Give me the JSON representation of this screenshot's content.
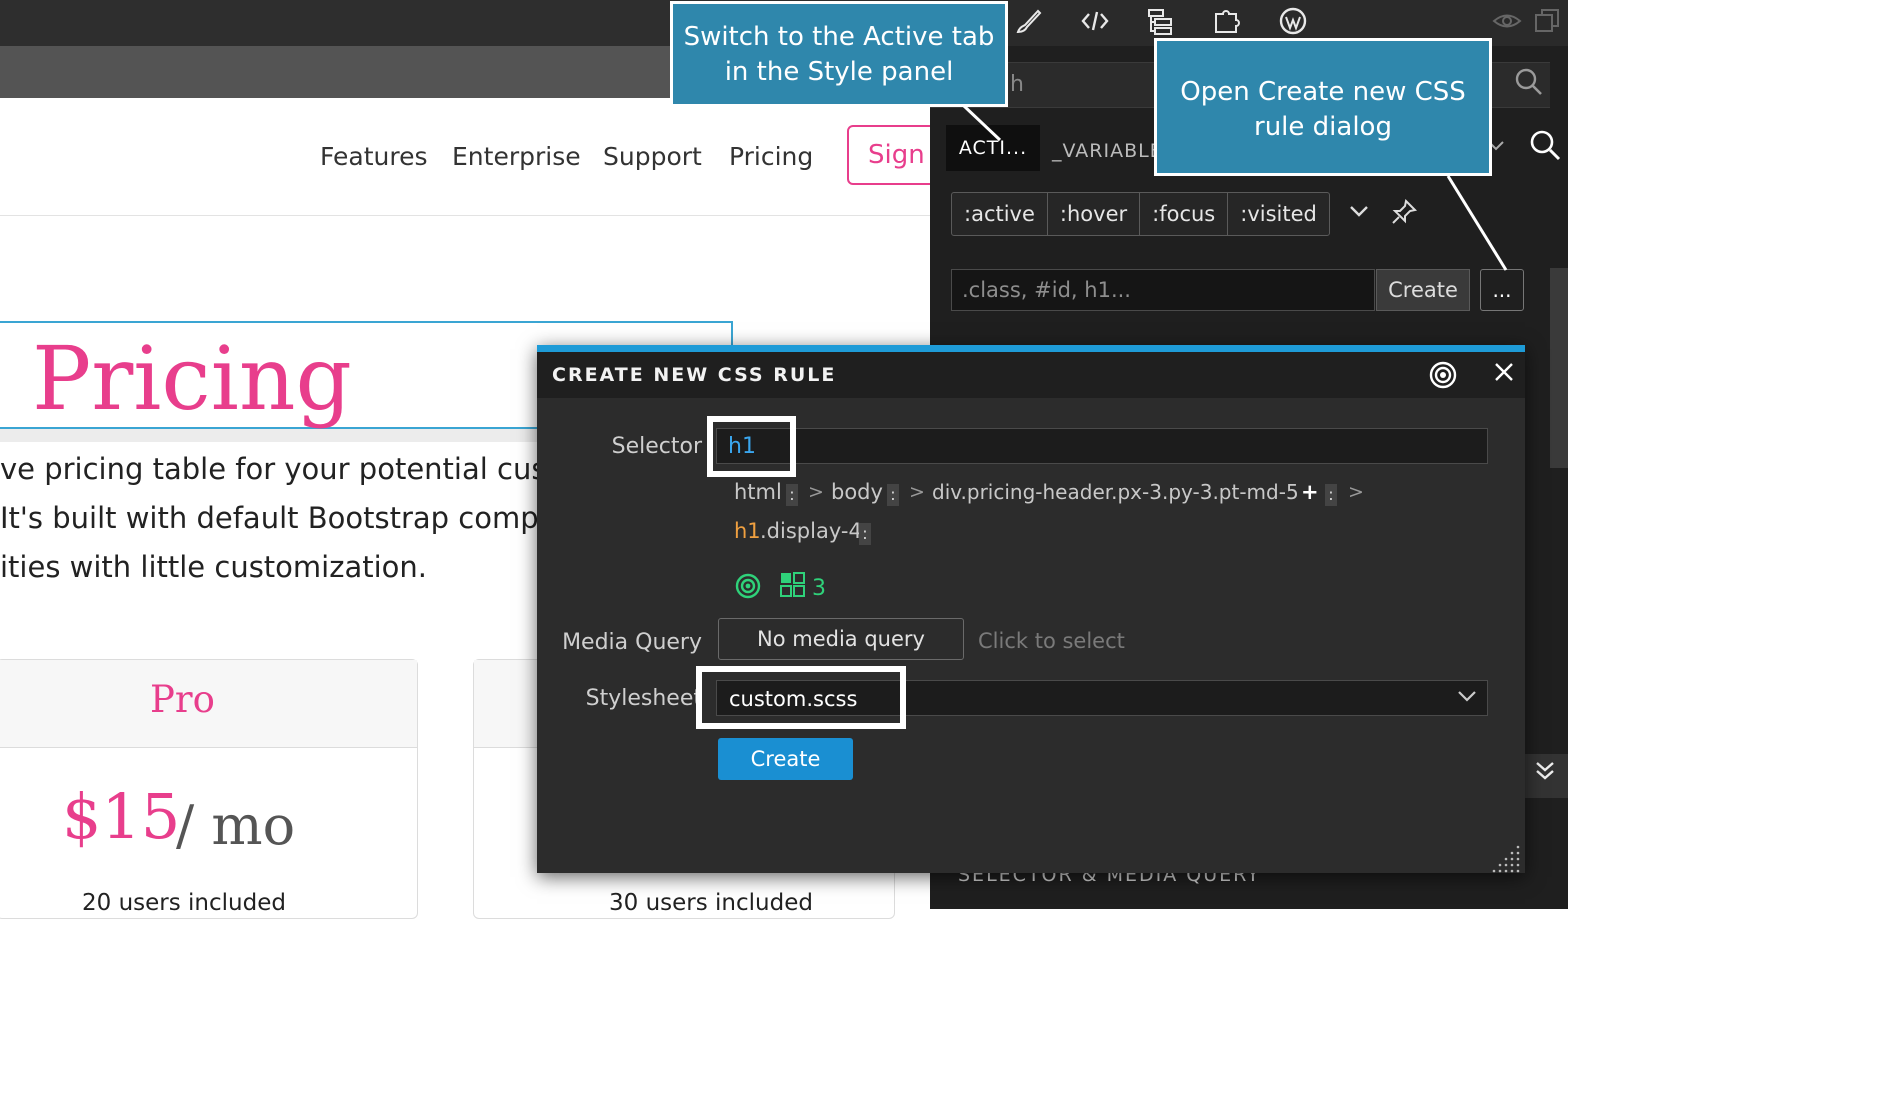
{
  "site": {
    "nav": [
      "Features",
      "Enterprise",
      "Support",
      "Pricing"
    ],
    "signin": "Sign i",
    "heading": "Pricing",
    "lead": [
      "ve pricing table for your potential cust",
      " It's built with default Bootstrap comp",
      "ities with little customization."
    ],
    "card_title": "Pro",
    "price": "$15",
    "per": "/ mo",
    "users_1": "20 users included",
    "users_2": "30 users included"
  },
  "panel": {
    "search_partial": "h",
    "tab_active": "ACTI...",
    "tab_variables": "_VARIABLE",
    "pseudo": [
      ":active",
      ":hover",
      ":focus",
      ":visited"
    ],
    "class_placeholder": ".class, #id, h1...",
    "create_label": "Create",
    "more_label": "...",
    "section_label": "SELECTOR & MEDIA QUERY"
  },
  "dialog": {
    "title": "CREATE NEW CSS RULE",
    "selector_label": "Selector",
    "selector_value": "h1",
    "crumbs": [
      "html",
      "body",
      "div.pricing-header.px-3.py-3.pt-md-5"
    ],
    "crumb_plus": "+",
    "last_tag": "h1",
    "last_class": ".display-4",
    "match_count": "3",
    "media_label": "Media Query",
    "media_value": "No media query",
    "media_hint": "Click to select",
    "stylesheet_label": "Stylesheet",
    "stylesheet_value": "custom.scss",
    "create_label": "Create"
  },
  "callouts": {
    "c1_line1": "Switch to the Active tab",
    "c1_line2": "in the Style panel",
    "c2_line1": "Open Create new CSS",
    "c2_line2": "rule dialog"
  },
  "colors": {
    "brand_pink": "#e83e8c",
    "accent_blue": "#1e9bd7",
    "callout_blue": "#2f87ac",
    "match_green": "#2fd27a"
  }
}
